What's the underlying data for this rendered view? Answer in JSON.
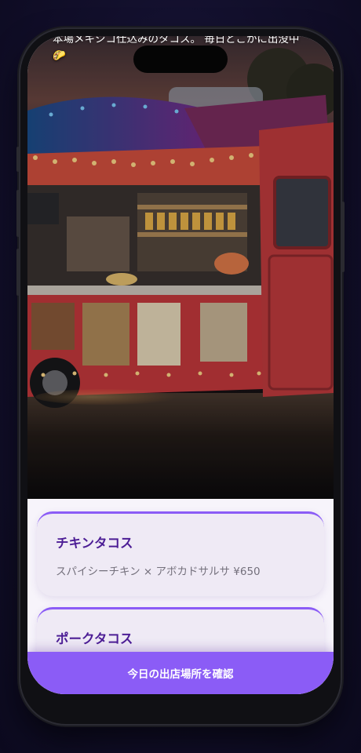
{
  "hero": {
    "caption": "本場メキシコ仕込みのタコス。 毎日どこかに出没中🌮"
  },
  "menu": {
    "items": [
      {
        "name": "チキンタコス",
        "description": "スパイシーチキン × アボカドサルサ ¥650"
      },
      {
        "name": "ポークタコス",
        "description": ""
      }
    ]
  },
  "cta": {
    "label": "今日の出店場所を確認"
  },
  "colors": {
    "accent": "#8b5cf6",
    "title": "#4c1d95",
    "card": "#efeaf5",
    "truck_body": "#c5393c"
  }
}
